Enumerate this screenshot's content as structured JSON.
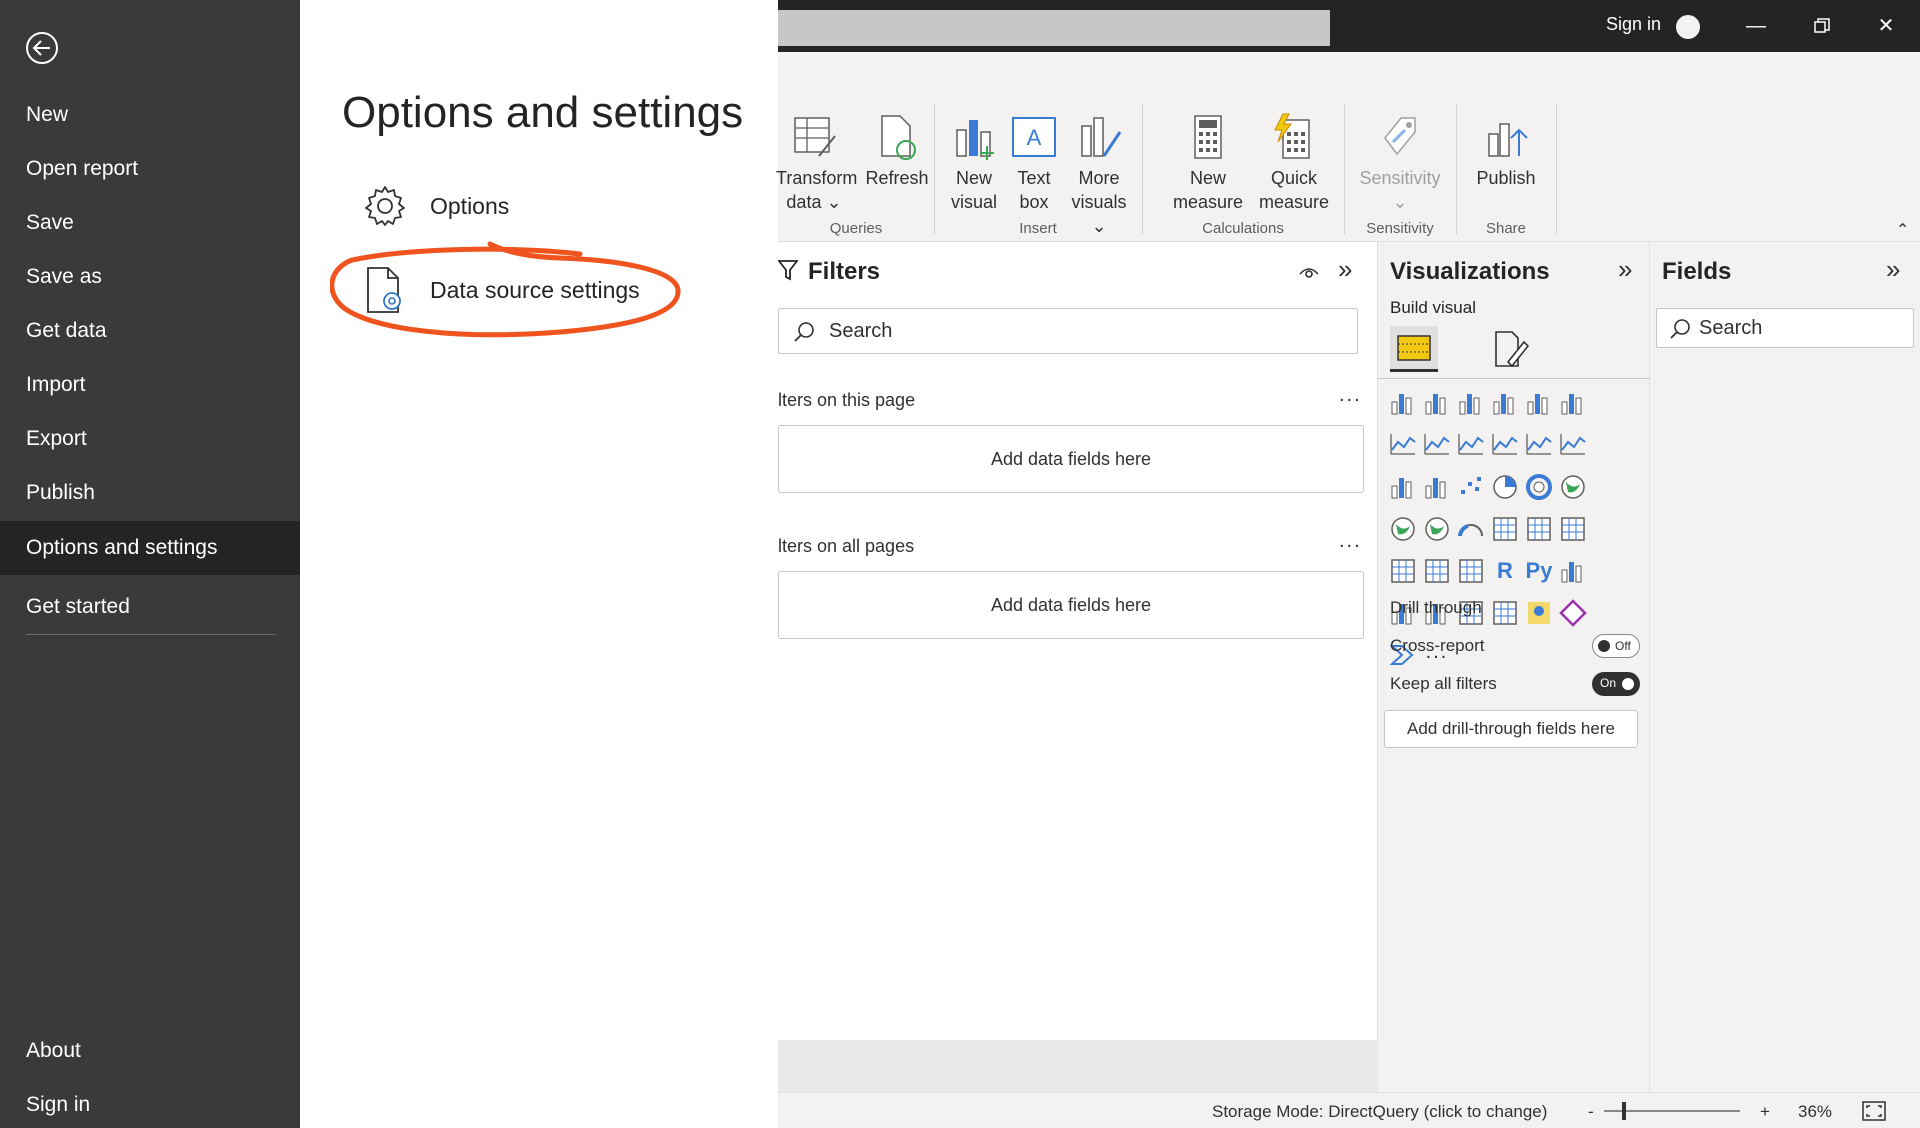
{
  "nav": {
    "items": [
      {
        "label": "New"
      },
      {
        "label": "Open report"
      },
      {
        "label": "Save"
      },
      {
        "label": "Save as"
      },
      {
        "label": "Get data"
      },
      {
        "label": "Import"
      },
      {
        "label": "Export"
      },
      {
        "label": "Publish"
      },
      {
        "label": "Options and settings"
      },
      {
        "label": "Get started"
      }
    ],
    "bottom": [
      {
        "label": "About"
      },
      {
        "label": "Sign in"
      }
    ]
  },
  "options_panel": {
    "title": "Options and settings",
    "options_label": "Options",
    "data_source_label": "Data source settings",
    "annotation_color": "#f0541e"
  },
  "titlebar": {
    "sign_in": "Sign in"
  },
  "ribbon": {
    "buttons": {
      "transform": "Transform",
      "transform2": "data",
      "refresh": "Refresh",
      "new_visual": "New",
      "new_visual2": "visual",
      "text_box": "Text",
      "text_box2": "box",
      "more_visuals": "More",
      "more_visuals2": "visuals",
      "new_measure": "New",
      "new_measure2": "measure",
      "quick_measure": "Quick",
      "quick_measure2": "measure",
      "sensitivity": "Sensitivity",
      "publish": "Publish"
    },
    "groups": {
      "queries": "Queries",
      "insert": "Insert",
      "calculations": "Calculations",
      "sensitivity": "Sensitivity",
      "share": "Share"
    }
  },
  "filters": {
    "title": "Filters",
    "search": "Search",
    "this_page": "lters on this page",
    "all_pages": "lters on all pages",
    "add_fields": "Add data fields here",
    "ellipsis": "..."
  },
  "visualizations": {
    "title": "Visualizations",
    "build_visual": "Build visual",
    "r_label": "R",
    "py_label": "Py",
    "more": "...",
    "drill_through": "Drill through",
    "cross_report": "Cross-report",
    "cross_report_state": "Off",
    "keep_filters": "Keep all filters",
    "keep_filters_state": "On",
    "add_drill": "Add drill-through fields here"
  },
  "fields": {
    "title": "Fields",
    "search": "Search"
  },
  "status": {
    "storage_mode": "Storage Mode: DirectQuery (click to change)",
    "minus": "-",
    "plus": "+",
    "zoom": "36%"
  },
  "colors": {
    "nav_bg": "#3b3a39",
    "nav_active": "#252423",
    "titlebar": "#252423",
    "accent_blue": "#3a7bd5",
    "accent_yellow": "#f2c811"
  }
}
